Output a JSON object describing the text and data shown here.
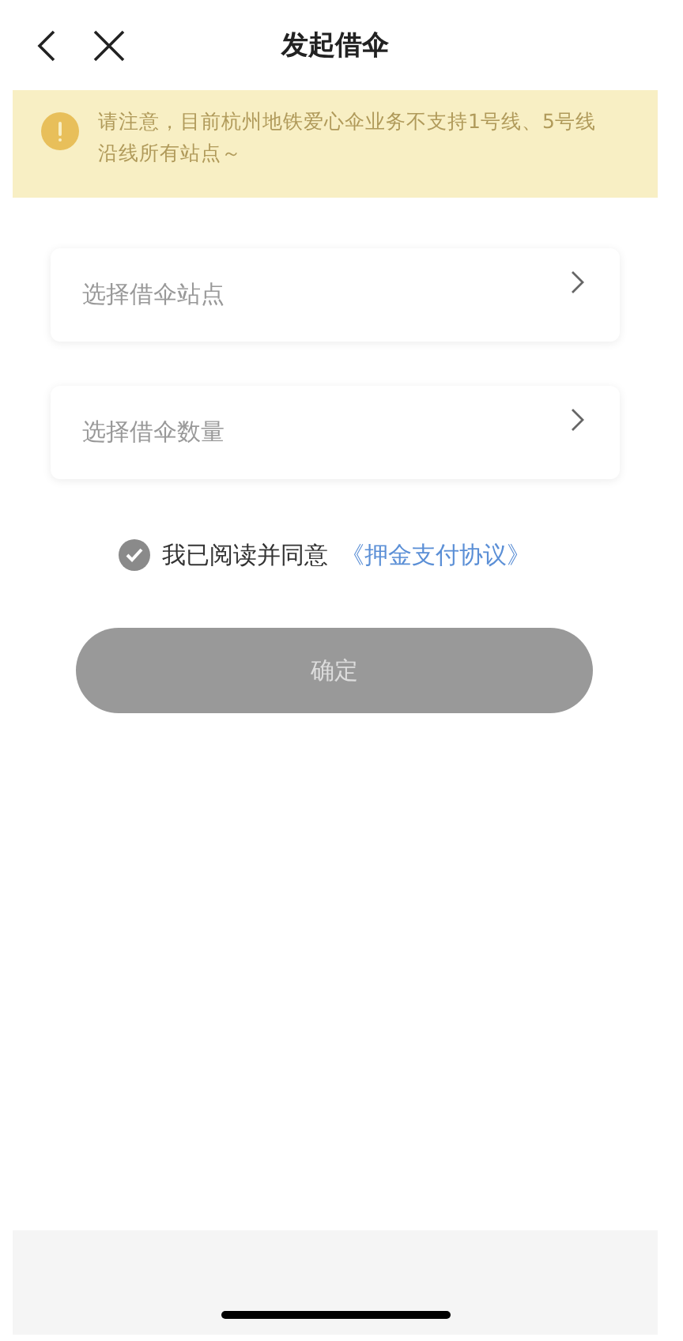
{
  "header": {
    "title": "发起借伞"
  },
  "notice": {
    "text": "请注意，目前杭州地铁爱心伞业务不支持1号线、5号线沿线所有站点～"
  },
  "fields": [
    {
      "placeholder": "选择借伞站点"
    },
    {
      "placeholder": "选择借伞数量"
    }
  ],
  "agreement": {
    "checked": true,
    "text": "我已阅读并同意",
    "link": "《押金支付协议》"
  },
  "confirm_button": {
    "label": "确定",
    "disabled": true
  }
}
